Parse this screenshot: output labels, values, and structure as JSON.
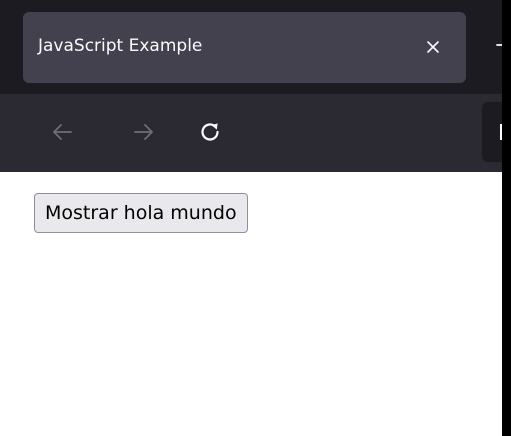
{
  "tab": {
    "title": "JavaScript Example",
    "close_icon": "close-icon"
  },
  "navbar": {
    "back_icon": "arrow-left-icon",
    "forward_icon": "arrow-right-icon",
    "reload_icon": "reload-icon"
  },
  "page": {
    "button_label": "Mostrar hola mundo"
  },
  "colors": {
    "tabbar_bg": "#1c1b22",
    "tab_bg": "#42414d",
    "navbar_bg": "#2b2a33",
    "text": "#fbfbfe",
    "disabled_icon": "#6f6e76",
    "content_bg": "#ffffff"
  }
}
